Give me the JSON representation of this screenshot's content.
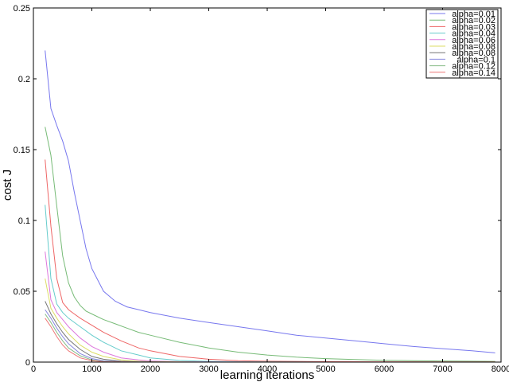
{
  "chart_data": {
    "type": "line",
    "title": "",
    "xlabel": "learning iterations",
    "ylabel": "cost J",
    "xlim": [
      0,
      8000
    ],
    "ylim": [
      0,
      0.25
    ],
    "xticks": [
      "0",
      "1000",
      "2000",
      "3000",
      "4000",
      "5000",
      "6000",
      "7000",
      "8000"
    ],
    "yticks": [
      "0",
      "0.05",
      "0.1",
      "0.15",
      "0.2",
      "0.25"
    ],
    "grid": false,
    "legend_position": "top-right",
    "series": [
      {
        "name": "alpha=0.01",
        "color": "#7777ee",
        "x": [
          200,
          300,
          400,
          500,
          600,
          700,
          800,
          900,
          1000,
          1200,
          1400,
          1600,
          1800,
          2000,
          2500,
          3000,
          3500,
          4000,
          4500,
          5000,
          5500,
          6000,
          6500,
          7000,
          7500,
          7900
        ],
        "y": [
          0.22,
          0.179,
          0.167,
          0.156,
          0.142,
          0.12,
          0.1,
          0.08,
          0.066,
          0.05,
          0.043,
          0.039,
          0.037,
          0.035,
          0.031,
          0.028,
          0.025,
          0.022,
          0.019,
          0.017,
          0.015,
          0.013,
          0.011,
          0.0095,
          0.008,
          0.0065
        ]
      },
      {
        "name": "alpha=0.02",
        "color": "#77bb77",
        "x": [
          200,
          300,
          400,
          500,
          600,
          700,
          800,
          900,
          1000,
          1200,
          1400,
          1600,
          1800,
          2000,
          2500,
          3000,
          3500,
          4000,
          4500,
          5000,
          5500,
          6000,
          6500,
          7000,
          7500,
          7900
        ],
        "y": [
          0.166,
          0.146,
          0.11,
          0.075,
          0.056,
          0.046,
          0.04,
          0.036,
          0.034,
          0.03,
          0.027,
          0.024,
          0.021,
          0.019,
          0.014,
          0.01,
          0.007,
          0.005,
          0.0035,
          0.0025,
          0.0018,
          0.0013,
          0.001,
          0.0008,
          0.0006,
          0.0005
        ]
      },
      {
        "name": "alpha=0.03",
        "color": "#ee6666",
        "x": [
          200,
          300,
          400,
          500,
          600,
          700,
          800,
          1000,
          1200,
          1500,
          1800,
          2000,
          2500,
          3000,
          3500,
          4000,
          5000,
          6000,
          7000,
          7900
        ],
        "y": [
          0.143,
          0.096,
          0.059,
          0.042,
          0.037,
          0.034,
          0.031,
          0.026,
          0.021,
          0.015,
          0.01,
          0.008,
          0.004,
          0.002,
          0.001,
          0.0006,
          0.0003,
          0.0002,
          0.0001,
          0.0001
        ]
      },
      {
        "name": "alpha=0.04",
        "color": "#66cccc",
        "x": [
          200,
          300,
          400,
          500,
          600,
          800,
          1000,
          1200,
          1500,
          1800,
          2000,
          2500,
          3000,
          3500,
          4000,
          5000,
          6000,
          7000,
          7900
        ],
        "y": [
          0.111,
          0.059,
          0.041,
          0.035,
          0.031,
          0.025,
          0.019,
          0.014,
          0.008,
          0.005,
          0.003,
          0.0012,
          0.0005,
          0.0002,
          0.0001,
          0,
          0,
          0,
          0
        ]
      },
      {
        "name": "alpha=0.06",
        "color": "#dd77dd",
        "x": [
          200,
          300,
          400,
          500,
          600,
          800,
          1000,
          1200,
          1500,
          1800,
          2000,
          2500,
          3000,
          4000,
          5000,
          6000,
          7000,
          7900
        ],
        "y": [
          0.078,
          0.044,
          0.035,
          0.03,
          0.025,
          0.017,
          0.011,
          0.007,
          0.003,
          0.0015,
          0.0008,
          0.0003,
          0.0001,
          0,
          0,
          0,
          0,
          0
        ]
      },
      {
        "name": "alpha=0.08",
        "color": "#dddd66",
        "x": [
          200,
          300,
          400,
          500,
          600,
          800,
          1000,
          1200,
          1500,
          1800,
          2000,
          2500,
          3000,
          4000,
          5000,
          6000,
          7000,
          7900
        ],
        "y": [
          0.059,
          0.038,
          0.031,
          0.025,
          0.02,
          0.012,
          0.007,
          0.004,
          0.0015,
          0.0006,
          0.0003,
          0.0001,
          0,
          0,
          0,
          0,
          0,
          0
        ]
      },
      {
        "name": "alpha=0.08",
        "color": "#777777",
        "x": [
          200,
          300,
          400,
          500,
          600,
          800,
          1000,
          1200,
          1500,
          1800,
          2000,
          2500,
          3000,
          4000,
          5000,
          6000,
          7000,
          7900
        ],
        "y": [
          0.043,
          0.034,
          0.027,
          0.021,
          0.016,
          0.009,
          0.004,
          0.002,
          0.0006,
          0.0002,
          0.0001,
          0,
          0,
          0,
          0,
          0,
          0,
          0
        ]
      },
      {
        "name": "alpha=0.1",
        "color": "#8888dd",
        "x": [
          200,
          300,
          400,
          500,
          600,
          800,
          1000,
          1200,
          1500,
          1800,
          2000,
          3000,
          4000,
          5000,
          6000,
          7000,
          7900
        ],
        "y": [
          0.037,
          0.031,
          0.024,
          0.018,
          0.013,
          0.006,
          0.0025,
          0.001,
          0.0003,
          0.0001,
          0,
          0,
          0,
          0,
          0,
          0,
          0
        ]
      },
      {
        "name": "alpha=0.12",
        "color": "#88bb88",
        "x": [
          200,
          300,
          400,
          500,
          600,
          800,
          1000,
          1200,
          1500,
          2000,
          3000,
          4000,
          5000,
          6000,
          7000,
          7900
        ],
        "y": [
          0.034,
          0.028,
          0.021,
          0.015,
          0.01,
          0.0045,
          0.0015,
          0.0005,
          0.0001,
          0,
          0,
          0,
          0,
          0,
          0,
          0
        ]
      },
      {
        "name": "alpha=0.14",
        "color": "#ee7777",
        "x": [
          200,
          300,
          400,
          500,
          600,
          800,
          1000,
          1200,
          1500,
          2000,
          3000,
          4000,
          5000,
          6000,
          7000,
          7900
        ],
        "y": [
          0.031,
          0.025,
          0.018,
          0.012,
          0.008,
          0.003,
          0.001,
          0.0003,
          0.0001,
          0,
          0,
          0,
          0,
          0,
          0,
          0
        ]
      }
    ]
  }
}
